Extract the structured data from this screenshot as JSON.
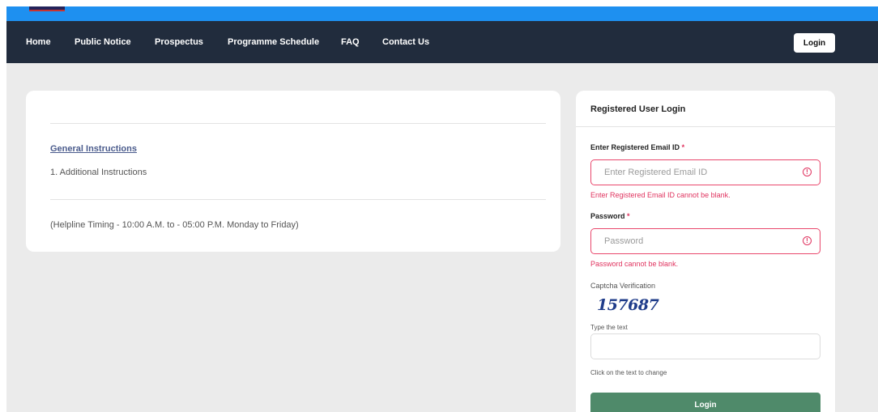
{
  "nav": {
    "items": [
      "Home",
      "Public Notice",
      "Prospectus",
      "Programme Schedule",
      "FAQ",
      "Contact Us"
    ],
    "login_label": "Login"
  },
  "instructions": {
    "general_title": "General Instructions",
    "items": [
      "1. Additional Instructions"
    ],
    "helpline": "(Helpline Timing - 10:00 A.M. to - 05:00 P.M. Monday to Friday)"
  },
  "login": {
    "title": "Registered User Login",
    "email": {
      "label": "Enter Registered Email ID",
      "required_mark": "*",
      "placeholder": "Enter Registered Email ID",
      "value": "",
      "error": "Enter Registered Email ID cannot be blank."
    },
    "password": {
      "label": "Password",
      "required_mark": "*",
      "placeholder": "Password",
      "value": "",
      "error": "Password cannot be blank."
    },
    "captcha": {
      "label": "Captcha Verification",
      "code": "157687",
      "input_label": "Type the text",
      "value": "",
      "hint": "Click on the text to change"
    },
    "submit_label": "Login"
  },
  "colors": {
    "header_blue": "#1e90f0",
    "nav_bg": "#212c3d",
    "error": "#e0335f",
    "login_button": "#4f8a6a",
    "page_bg": "#ebebeb"
  },
  "icons": {
    "error_icon": "exclamation-circle"
  }
}
